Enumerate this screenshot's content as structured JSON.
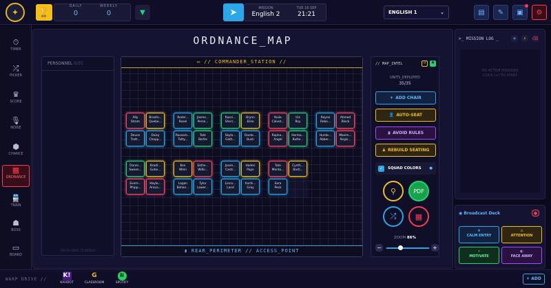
{
  "header": {
    "daily_label": "DAILY",
    "daily_value": "0",
    "weekly_label": "WEEKLY",
    "weekly_value": "0",
    "mission_label": "MISSION",
    "mission_value": "English 2",
    "date_label": "TUE 16 SEP",
    "time_value": "21:21",
    "class_select": "ENGLISH 1"
  },
  "sidebar": {
    "items": [
      {
        "label": "TIMER",
        "icon": "timer-icon"
      },
      {
        "label": "PICKER",
        "icon": "shuffle-icon"
      },
      {
        "label": "SCORE",
        "icon": "trophy-icon"
      },
      {
        "label": "NOISE",
        "icon": "mic-icon"
      },
      {
        "label": "CHANCE",
        "icon": "dice-icon"
      },
      {
        "label": "ORDNANCE",
        "icon": "map-icon"
      },
      {
        "label": "TRAIN",
        "icon": "train-icon"
      },
      {
        "label": "BOSS",
        "icon": "boss-icon"
      },
      {
        "label": "BOARD",
        "icon": "board-icon"
      }
    ]
  },
  "main": {
    "title": "ORDNANCE_MAP",
    "personnel_header": "PERSONNEL",
    "personnel_count": "0/35",
    "personnel_footer": "TAP OR DRAG TO DEPLOY",
    "station_header": "// COMMANDER_STATION //",
    "perimeter_footer": "REAR_PERIMETER // ACCESS_POINT",
    "clusters": [
      [
        {
          "first": "Ally",
          "last": "Strom",
          "c": "#ff4560"
        },
        {
          "first": "Braxto...",
          "last": "Quebe...",
          "c": "#f2c018"
        },
        {
          "first": "Devon",
          "last": "Tratt...",
          "c": "#2aa7e6"
        },
        {
          "first": "Daisy",
          "last": "Chapp...",
          "c": "#2aa7e6"
        }
      ],
      [
        {
          "first": "Roder...",
          "last": "Rosel",
          "c": "#2aa7e6"
        },
        {
          "first": "Jasme...",
          "last": "Perse...",
          "c": "#22d37a"
        },
        {
          "first": "Roseem...",
          "last": "Tatty...",
          "c": "#2aa7e6"
        },
        {
          "first": "Tate",
          "last": "Bartle",
          "c": "#22d37a"
        }
      ],
      [
        {
          "first": "Kassi...",
          "last": "Sherr...",
          "c": "#22d37a"
        },
        {
          "first": "Brynn",
          "last": "Elise",
          "c": "#f2c018"
        },
        {
          "first": "Skyla...",
          "last": "Gath...",
          "c": "#2aa7e6"
        },
        {
          "first": "Dante...",
          "last": "Bush",
          "c": "#2aa7e6"
        }
      ],
      [
        {
          "first": "Kaila",
          "last": "Calvet...",
          "c": "#ff4560"
        },
        {
          "first": "Iris",
          "last": "Roy",
          "c": "#22d37a"
        },
        {
          "first": "Rapha...",
          "last": "Angel",
          "c": "#ff4560"
        },
        {
          "first": "Herma...",
          "last": "Butte...",
          "c": "#22d37a"
        }
      ],
      [
        {
          "first": "Rayne",
          "last": "Rebe...",
          "c": "#2aa7e6"
        },
        {
          "first": "Ahmed",
          "last": "Block",
          "c": "#ff4560"
        },
        {
          "first": "Hunte...",
          "last": "Abber...",
          "c": "#2aa7e6"
        },
        {
          "first": "Maxim...",
          "last": "Regis...",
          "c": "#ff4560"
        }
      ],
      [
        {
          "first": "Donni...",
          "last": "Sween...",
          "c": "#22d37a"
        },
        {
          "first": "Bradl...",
          "last": "Gutie...",
          "c": "#f2c018"
        },
        {
          "first": "Evere...",
          "last": "Phipp...",
          "c": "#ff4560"
        },
        {
          "first": "Hayle...",
          "last": "Arava...",
          "c": "#ff4560"
        }
      ],
      [
        {
          "first": "Ken",
          "last": "Wren",
          "c": "#f2c018"
        },
        {
          "first": "Esthe...",
          "last": "Wilki...",
          "c": "#ff4560"
        },
        {
          "first": "Logan",
          "last": "Bohan...",
          "c": "#2aa7e6"
        },
        {
          "first": "Tylor",
          "last": "Lower...",
          "c": "#2aa7e6"
        }
      ],
      [
        {
          "first": "Jasen...",
          "last": "Castr...",
          "c": "#2aa7e6"
        },
        {
          "first": "Haden",
          "last": "Pope",
          "c": "#f2c018"
        },
        {
          "first": "Linco...",
          "last": "Land",
          "c": "#2aa7e6"
        },
        {
          "first": "Xochi...",
          "last": "Gray",
          "c": "#2aa7e6"
        }
      ],
      [
        {
          "first": "Tate",
          "last": "Monto...",
          "c": "#ff4560"
        },
        {
          "first": "Cynth...",
          "last": "Bartl...",
          "c": "#f2c018"
        },
        {
          "first": "Sara",
          "last": "Peck",
          "c": "#2aa7e6"
        }
      ]
    ]
  },
  "intel": {
    "header": "// MAP_INTEL",
    "units_label": "UNITS_DEPLOYED",
    "units_value": "35/35",
    "add_chair": "ADD CHAIR",
    "auto_seat": "AUTO-SEAT",
    "avoid_rules": "AVOID RULES",
    "rebuild_seating": "REBUILD SEATING",
    "squad_colors": "SQUAD COLORS",
    "zoom_label": "ZOOM",
    "zoom_value": "86%"
  },
  "mission_log": {
    "title": "MISSION LOG",
    "empty_line1": "NO ACTIVE MISSIONS",
    "empty_line2": "CLICK (+) TO START"
  },
  "broadcast": {
    "title": "Broadcast Deck",
    "buttons": [
      "CALM ENTRY",
      "ATTENTION",
      "MOTIVATE",
      "FACE AWAY"
    ]
  },
  "footer": {
    "warp_label": "WARP DRIVE //",
    "apps": [
      "KAHOOT",
      "CLASSROOM",
      "SPOTIFY"
    ],
    "add_label": "+ ADD"
  }
}
